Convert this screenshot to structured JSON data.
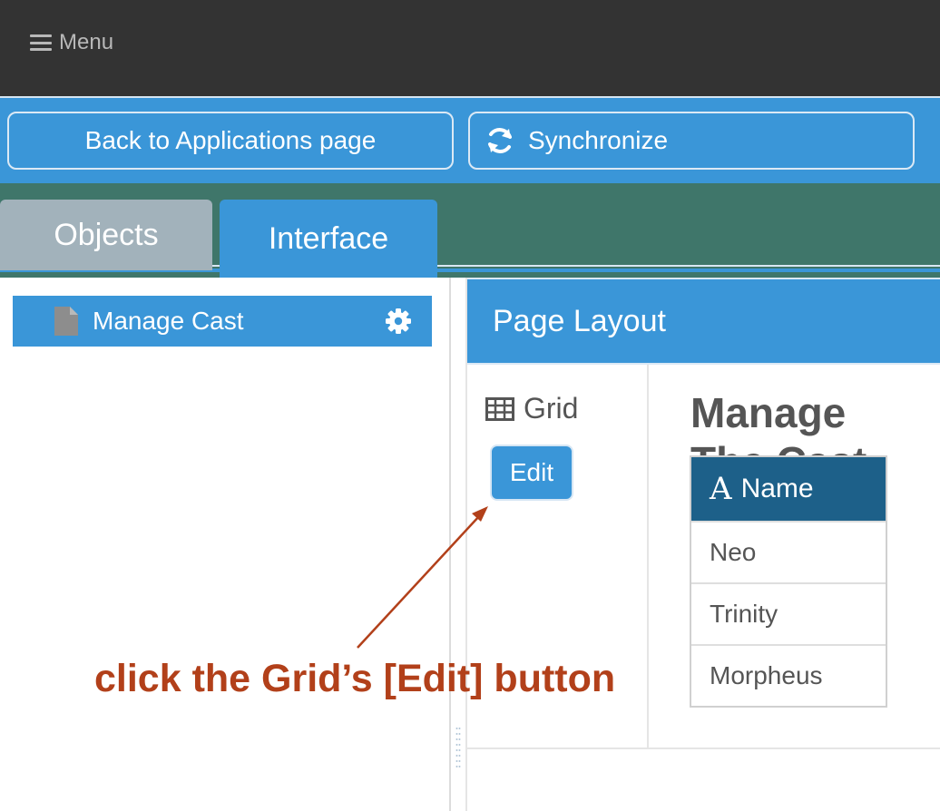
{
  "topbar": {
    "menu_label": "Menu",
    "menu_icon": "hamburger-icon"
  },
  "actions": {
    "back_label": "Back to Applications page",
    "sync_label": "Synchronize",
    "sync_icon": "refresh-icon"
  },
  "tabs": [
    {
      "label": "Objects",
      "active": false
    },
    {
      "label": "Interface",
      "active": true
    }
  ],
  "sidebar": {
    "pages": [
      {
        "label": "Manage Cast",
        "icon": "document-icon",
        "settings_icon": "gear-icon"
      }
    ]
  },
  "layout": {
    "title": "Page Layout",
    "components": [
      {
        "label": "Grid",
        "icon": "table-icon",
        "edit_label": "Edit"
      }
    ],
    "preview": {
      "title": "Manage The Cast",
      "grid": {
        "header": "Name",
        "header_icon": "font-icon",
        "header_icon_glyph": "A",
        "rows": [
          "Neo",
          "Trinity",
          "Morpheus"
        ]
      }
    }
  },
  "annotation": {
    "text": "click the Grid’s [Edit] button",
    "color": "#b2401a"
  },
  "colors": {
    "topbar": "#333333",
    "primary": "#3a96d8",
    "tabstrip": "#3f766a",
    "inactive_tab": "#a2b2bb",
    "grid_header": "#1d6089"
  }
}
